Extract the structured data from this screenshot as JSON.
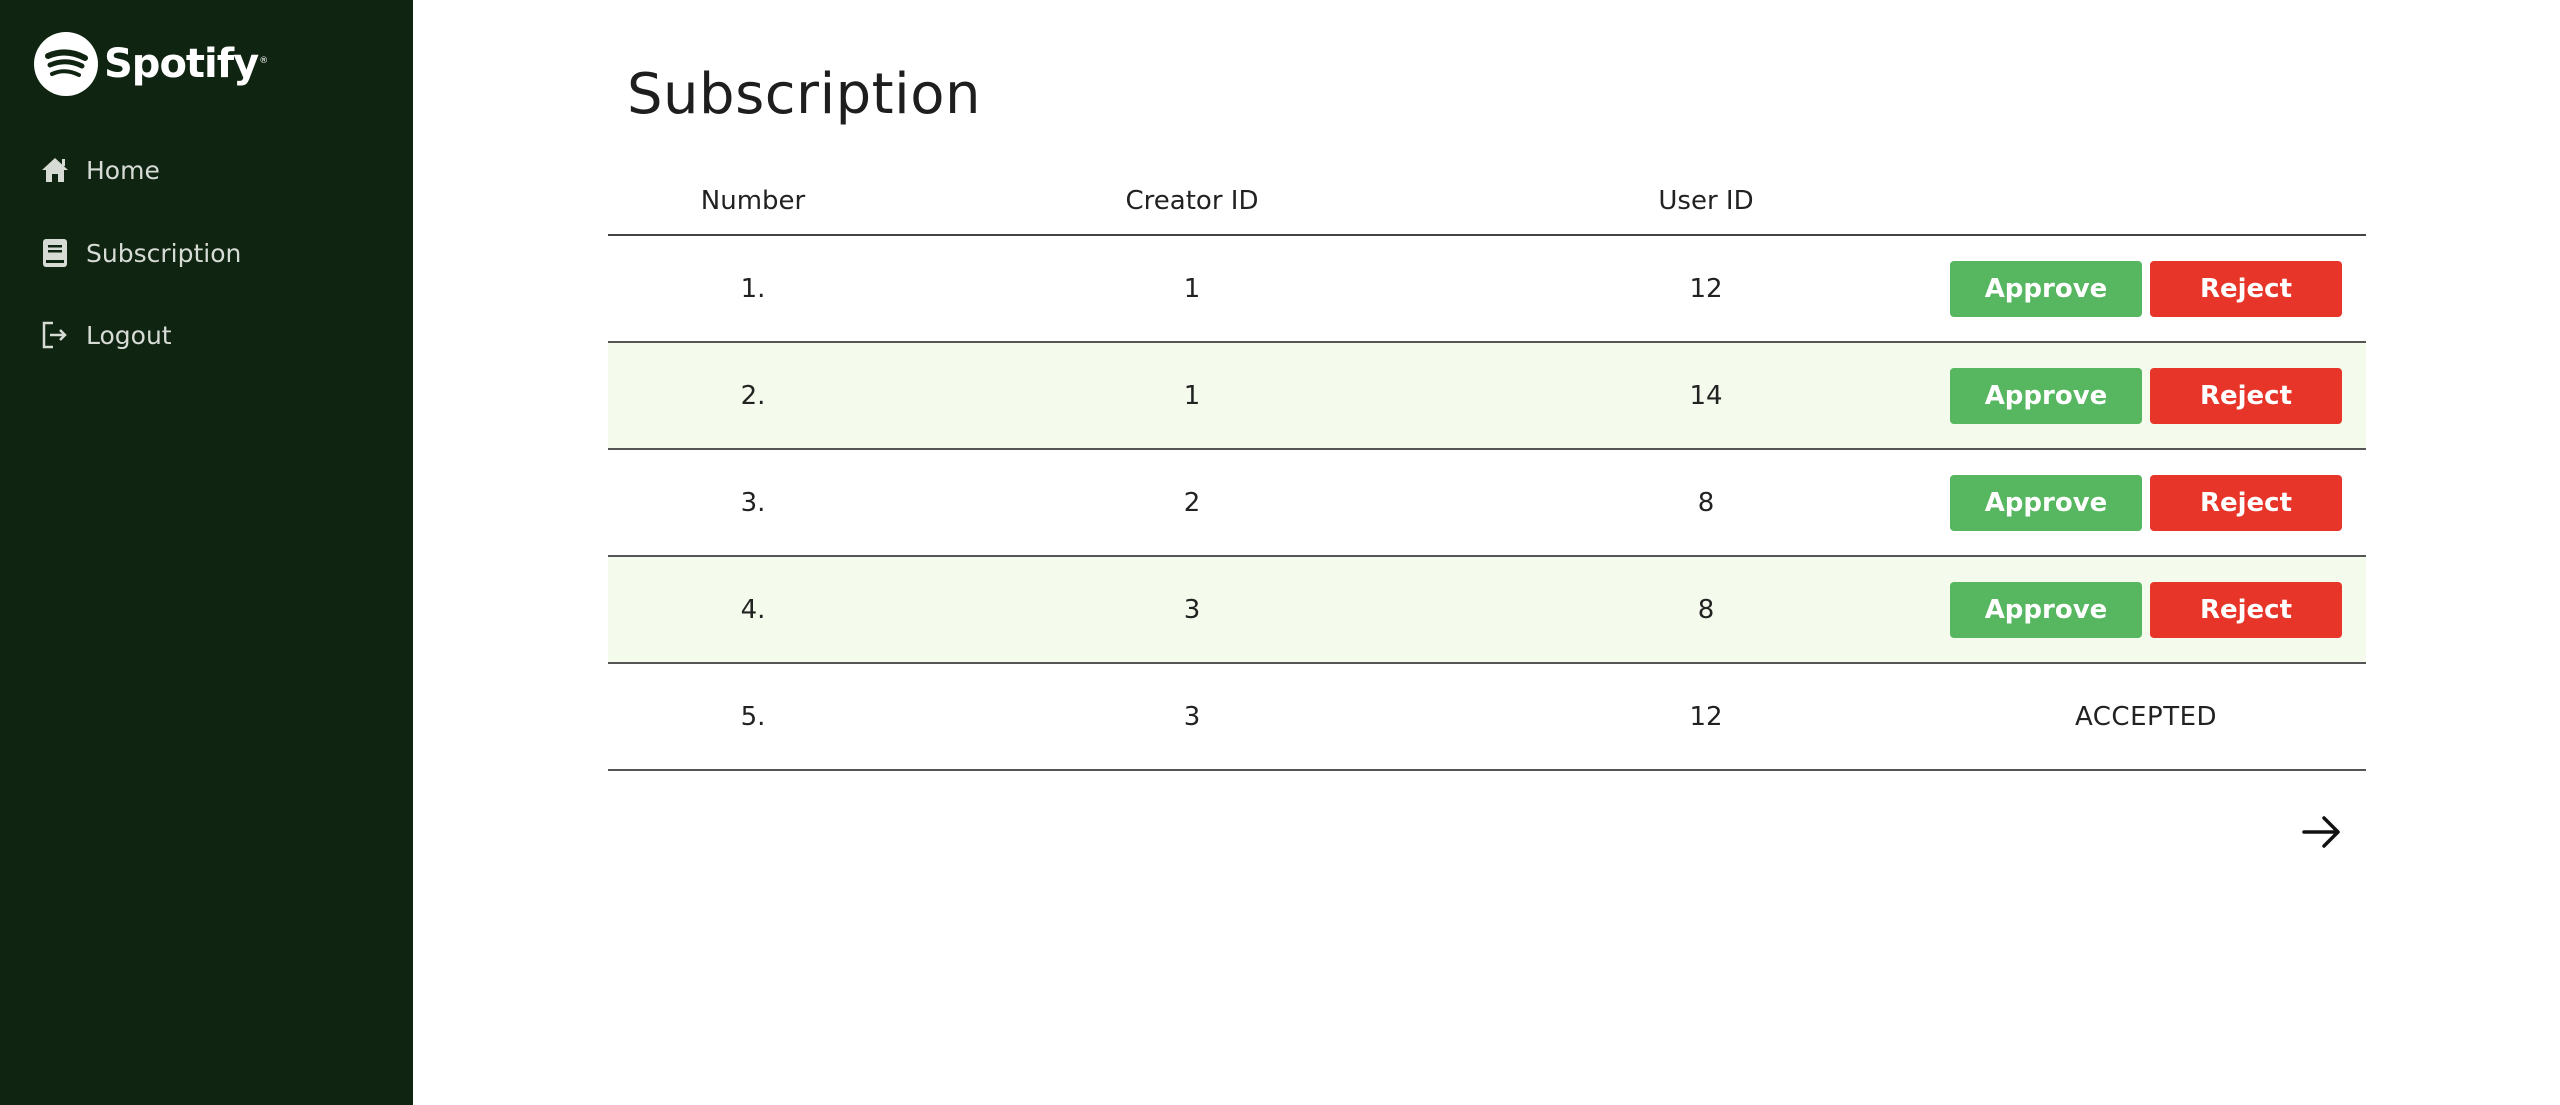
{
  "app": {
    "logo_text": "Spotify",
    "logo_reg": "®"
  },
  "sidebar": {
    "items": [
      {
        "label": "Home",
        "icon": "home-icon"
      },
      {
        "label": "Subscription",
        "icon": "book-icon"
      },
      {
        "label": "Logout",
        "icon": "logout-icon"
      }
    ]
  },
  "main": {
    "title": "Subscription",
    "columns": [
      "Number",
      "Creator ID",
      "User ID",
      ""
    ],
    "rows": [
      {
        "number": "1.",
        "creator_id": "1",
        "user_id": "12",
        "approve": "Approve",
        "reject": "Reject"
      },
      {
        "number": "2.",
        "creator_id": "1",
        "user_id": "14",
        "approve": "Approve",
        "reject": "Reject"
      },
      {
        "number": "3.",
        "creator_id": "2",
        "user_id": "8",
        "approve": "Approve",
        "reject": "Reject"
      },
      {
        "number": "4.",
        "creator_id": "3",
        "user_id": "8",
        "approve": "Approve",
        "reject": "Reject"
      },
      {
        "number": "5.",
        "creator_id": "3",
        "user_id": "12",
        "status": "ACCEPTED"
      }
    ],
    "next_icon": "arrow-right-icon"
  },
  "colors": {
    "sidebar_bg": "#0f2411",
    "approve": "#57b660",
    "reject": "#e8352a",
    "alt_row": "#f4fbec"
  }
}
